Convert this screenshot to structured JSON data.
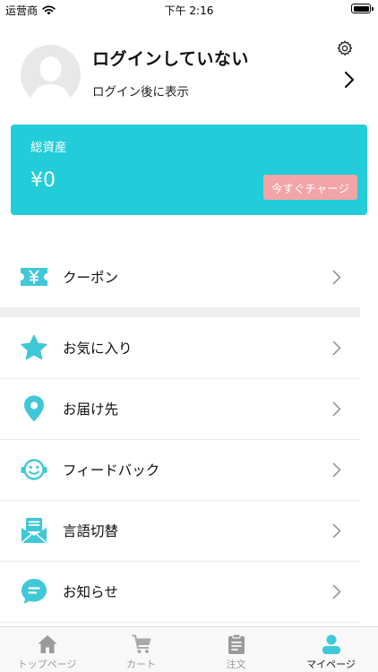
{
  "status_bar": {
    "carrier": "运营商",
    "time": "下午 2:16"
  },
  "profile": {
    "name": "ログインしていない",
    "subtitle": "ログイン後に表示"
  },
  "asset": {
    "label": "総資産",
    "value": "¥0",
    "charge_label": "今すぐチャージ"
  },
  "menu": [
    {
      "label": "クーポン",
      "icon": "ticket-icon"
    },
    {
      "label": "お気に入り",
      "icon": "star-icon"
    },
    {
      "label": "お届け先",
      "icon": "location-pin-icon"
    },
    {
      "label": "フィードバック",
      "icon": "smiley-headset-icon"
    },
    {
      "label": "言語切替",
      "icon": "envelope-icon"
    },
    {
      "label": "お知らせ",
      "icon": "chat-bubble-icon"
    }
  ],
  "tabs": [
    {
      "label": "トップページ",
      "icon": "home-icon",
      "active": false
    },
    {
      "label": "カート",
      "icon": "cart-icon",
      "active": false
    },
    {
      "label": "注文",
      "icon": "clipboard-icon",
      "active": false
    },
    {
      "label": "マイページ",
      "icon": "person-icon",
      "active": true
    }
  ],
  "colors": {
    "accent": "#22cdd9",
    "charge_button": "#f3a4a6",
    "icon": "#3fc8d8",
    "inactive_tab": "#9a9a9a"
  }
}
